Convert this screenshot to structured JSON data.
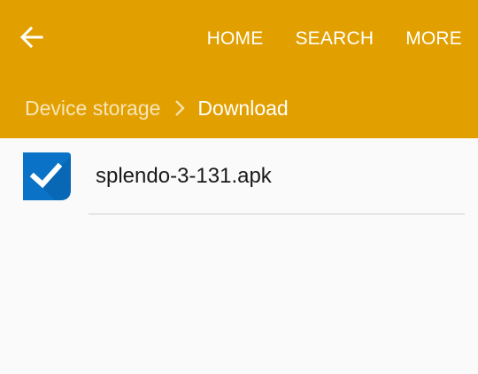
{
  "toolbar": {
    "back_icon": "arrow-left-icon",
    "actions": [
      {
        "label": "HOME"
      },
      {
        "label": "SEARCH"
      },
      {
        "label": "MORE"
      }
    ]
  },
  "breadcrumb": {
    "parent": "Device storage",
    "separator_icon": "chevron-right-icon",
    "current": "Download"
  },
  "files": [
    {
      "name": "splendo-3-131.apk",
      "icon": "task-checkbox-app-icon",
      "checked": true
    }
  ],
  "colors": {
    "header_bg": "#e2a000",
    "list_bg": "#fafafa",
    "icon_blue": "#0a73c7"
  }
}
